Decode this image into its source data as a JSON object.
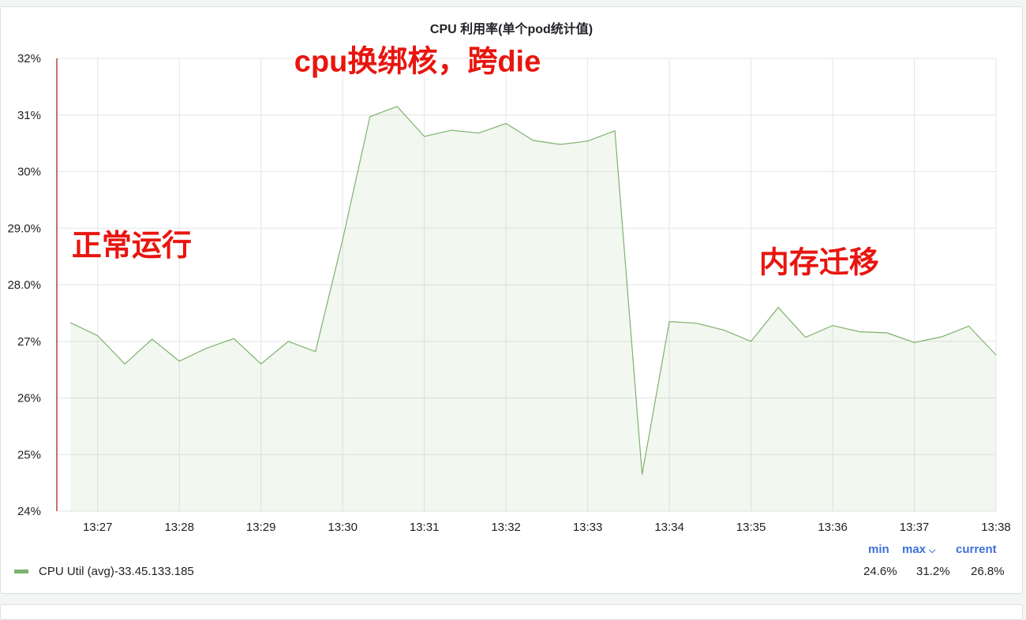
{
  "panel": {
    "title": "CPU 利用率(单个pod统计值)"
  },
  "legend": {
    "series_name": "CPU Util (avg)-33.45.133.185",
    "swatch_color": "#7eb26d",
    "headers": {
      "min": "min",
      "max": "max",
      "current": "current"
    },
    "values": {
      "min": "24.6%",
      "max": "31.2%",
      "current": "26.8%"
    },
    "sort_icon": "chevron-down-icon"
  },
  "annotations": [
    {
      "text": "cpu换绑核，跨die",
      "time": "13:30:55",
      "value": 31.95
    },
    {
      "text": "正常运行",
      "time": "13:27:25",
      "value": 28.7
    },
    {
      "text": "内存迁移",
      "time": "13:35:50",
      "value": 28.4
    }
  ],
  "chart_data": {
    "type": "area",
    "title": "CPU 利用率(单个pod统计值)",
    "series": [
      {
        "name": "CPU Util (avg)-33.45.133.185",
        "color": "#7eb26d",
        "x": [
          "13:26:40",
          "13:27:00",
          "13:27:20",
          "13:27:40",
          "13:28:00",
          "13:28:20",
          "13:28:40",
          "13:29:00",
          "13:29:20",
          "13:29:40",
          "13:30:00",
          "13:30:20",
          "13:30:40",
          "13:31:00",
          "13:31:20",
          "13:31:40",
          "13:32:00",
          "13:32:20",
          "13:32:40",
          "13:33:00",
          "13:33:20",
          "13:33:40",
          "13:34:00",
          "13:34:20",
          "13:34:40",
          "13:35:00",
          "13:35:20",
          "13:35:40",
          "13:36:00",
          "13:36:20",
          "13:36:40",
          "13:37:00",
          "13:37:20",
          "13:37:40",
          "13:38:00"
        ],
        "values": [
          27.33,
          27.1,
          26.6,
          27.04,
          26.65,
          26.88,
          27.05,
          26.6,
          27.0,
          26.82,
          28.8,
          30.97,
          31.15,
          30.62,
          30.73,
          30.68,
          30.85,
          30.55,
          30.48,
          30.54,
          30.72,
          24.65,
          27.35,
          27.32,
          27.2,
          27.0,
          27.6,
          27.07,
          27.28,
          27.17,
          27.15,
          26.98,
          27.08,
          27.27,
          26.76
        ]
      }
    ],
    "xticks": [
      "13:27",
      "13:28",
      "13:29",
      "13:30",
      "13:31",
      "13:32",
      "13:33",
      "13:34",
      "13:35",
      "13:36",
      "13:37",
      "13:38"
    ],
    "yticks": [
      "24%",
      "25%",
      "26%",
      "27%",
      "28.0%",
      "29.0%",
      "30%",
      "31%",
      "32%"
    ],
    "ylim": [
      24,
      32
    ],
    "xlim": [
      "13:26:30",
      "13:38:00"
    ],
    "grid": true,
    "legend_position": "bottom-left",
    "xlabel": "",
    "ylabel": ""
  }
}
